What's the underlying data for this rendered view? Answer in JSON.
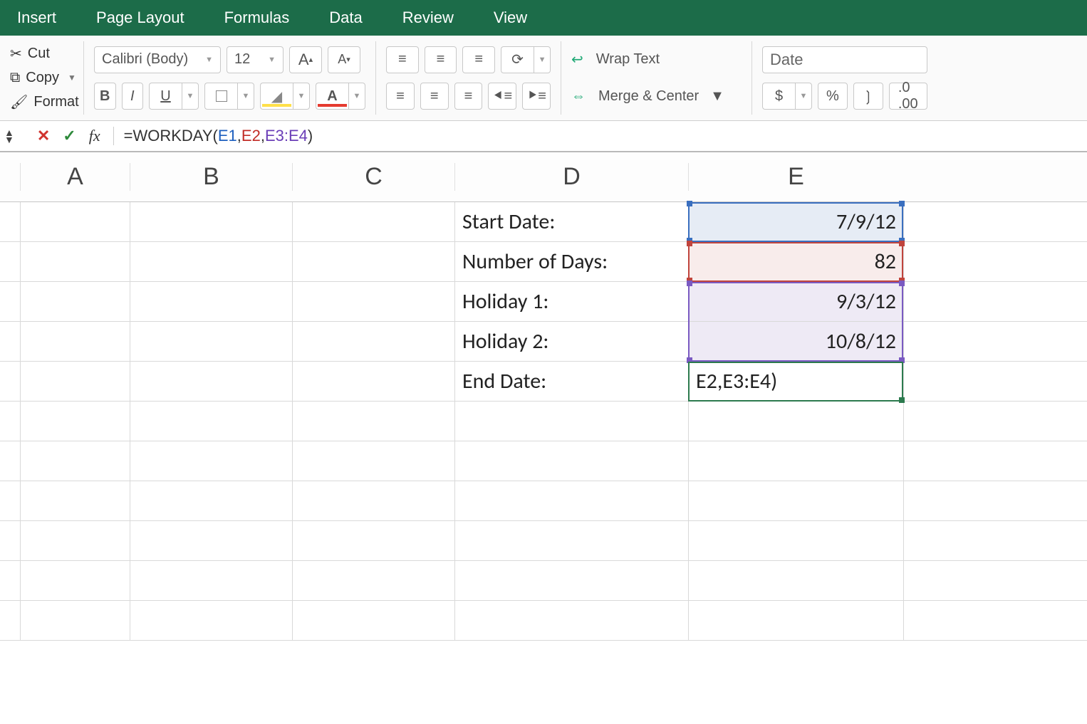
{
  "menubar": [
    "Insert",
    "Page Layout",
    "Formulas",
    "Data",
    "Review",
    "View"
  ],
  "clipboard": {
    "cut": "Cut",
    "copy": "Copy",
    "format": "Format"
  },
  "font": {
    "name": "Calibri (Body)",
    "size": "12",
    "growA": "A",
    "shrinkA": "A",
    "bold": "B",
    "italic": "I",
    "underline": "U",
    "fontcolorA": "A"
  },
  "wrapmerge": {
    "wrap": "Wrap Text",
    "merge": "Merge & Center"
  },
  "numfmt": {
    "category": "Date",
    "currency": "$",
    "percent": "%",
    "comma": "❳",
    "dec": "⁰₀"
  },
  "formula_bar": {
    "fx": "fx",
    "prefix": "=WORKDAY(",
    "arg1": "E1",
    "c1": ",",
    "arg2": "E2",
    "c2": ",",
    "arg3": "E3:E4",
    "suffix": ")"
  },
  "columns": [
    "A",
    "B",
    "C",
    "D",
    "E"
  ],
  "cells": {
    "D1": "Start Date:",
    "D2": "Number of Days:",
    "D3": "Holiday 1:",
    "D4": "Holiday 2:",
    "D5": "End Date:",
    "E1": "7/9/12",
    "E2": "82",
    "E3": "9/3/12",
    "E4": "10/8/12",
    "E5": "E2,E3:E4)"
  }
}
